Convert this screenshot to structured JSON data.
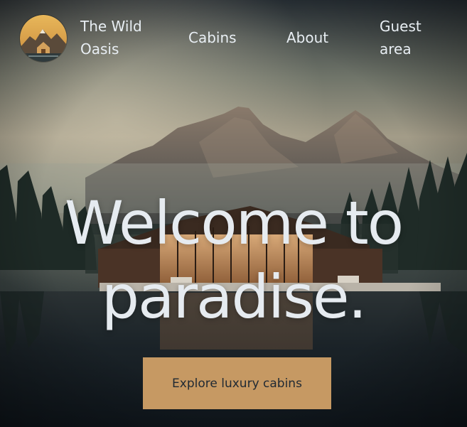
{
  "brand": {
    "name": "The Wild Oasis",
    "logo_icon": "mountain-cabin-logo-icon"
  },
  "nav": {
    "items": [
      {
        "label": "Cabins"
      },
      {
        "label": "About"
      },
      {
        "label": "Guest area"
      }
    ]
  },
  "hero": {
    "title": "Welcome to paradise.",
    "background_icon": "mountain-lake-cabin-photo",
    "cta_label": "Explore luxury cabins"
  },
  "colors": {
    "accent": "#c69963",
    "text_light": "#e8eef3",
    "text_dark": "#1f2933",
    "background": "#141c24"
  }
}
